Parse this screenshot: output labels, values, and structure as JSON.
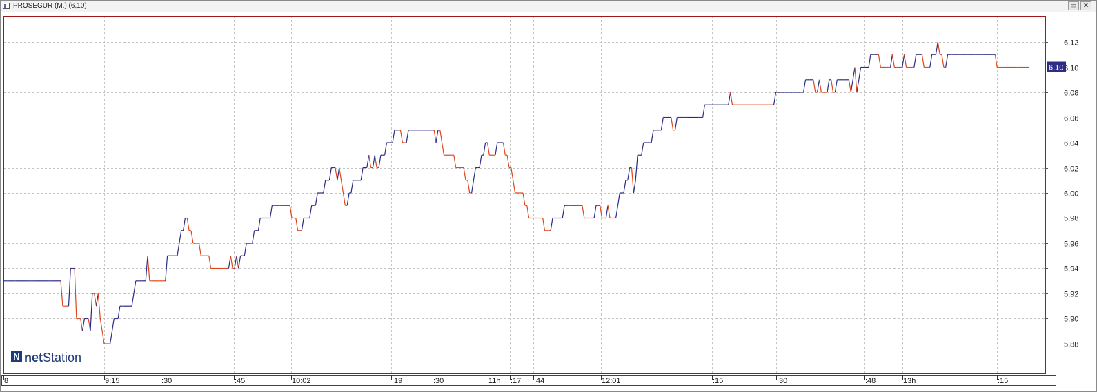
{
  "window": {
    "title": "PROSEGUR (M.) (6,10)",
    "restore_glyph": "▭",
    "close_glyph": "✕"
  },
  "brand": {
    "mark": "N",
    "bold": "net",
    "rest": "Station"
  },
  "colors": {
    "up": "#2a2a86",
    "down": "#e0441a",
    "grid": "#c4c4c4",
    "frame": "#a01818",
    "badge": "#2d2d86"
  },
  "chart_data": {
    "type": "line",
    "title": "PROSEGUR (M.) (6,10)",
    "ylim": [
      5.86,
      6.14
    ],
    "y_ticks": [
      "6,12",
      "6,10",
      "6,08",
      "6,06",
      "6,04",
      "6,02",
      "6,00",
      "5,98",
      "5,96",
      "5,94",
      "5,92",
      "5,90",
      "5,88"
    ],
    "x_ticks": [
      "8",
      "9:15",
      ":30",
      ":45",
      "10:02",
      ":19",
      ":30",
      "11h",
      ":17",
      ":44",
      "12:01",
      ":15",
      ":30",
      ":48",
      "13h",
      ":15"
    ],
    "last_value": "6,10",
    "grid": true,
    "series": [
      {
        "values": [
          5.93,
          5.93,
          5.93,
          5.93,
          5.93,
          5.93,
          5.93,
          5.93,
          5.93,
          5.93,
          5.93,
          5.93,
          5.93,
          5.93,
          5.93,
          5.93,
          5.93,
          5.93,
          5.93,
          5.93,
          5.93,
          5.93,
          5.93,
          5.93,
          5.93,
          5.93,
          5.93,
          5.93,
          5.93,
          5.93,
          5.91,
          5.91,
          5.91,
          5.91,
          5.94,
          5.94,
          5.94,
          5.9,
          5.9,
          5.9,
          5.89,
          5.9,
          5.9,
          5.9,
          5.89,
          5.92,
          5.92,
          5.91,
          5.92,
          5.9,
          5.89,
          5.88,
          5.88,
          5.88,
          5.88,
          5.89,
          5.9,
          5.9,
          5.9,
          5.91,
          5.91,
          5.91,
          5.91,
          5.91,
          5.91,
          5.91,
          5.92,
          5.93,
          5.93,
          5.93,
          5.93,
          5.93,
          5.93,
          5.95,
          5.93,
          5.93,
          5.93,
          5.93,
          5.93,
          5.93,
          5.93,
          5.93,
          5.93,
          5.95,
          5.95,
          5.95,
          5.95,
          5.95,
          5.95,
          5.96,
          5.97,
          5.97,
          5.98,
          5.98,
          5.97,
          5.97,
          5.96,
          5.96,
          5.96,
          5.96,
          5.95,
          5.95,
          5.95,
          5.95,
          5.95,
          5.94,
          5.94,
          5.94,
          5.94,
          5.94,
          5.94,
          5.94,
          5.94,
          5.94,
          5.94,
          5.95,
          5.94,
          5.94,
          5.95,
          5.94,
          5.95,
          5.95,
          5.95,
          5.96,
          5.96,
          5.96,
          5.96,
          5.97,
          5.97,
          5.97,
          5.98,
          5.98,
          5.98,
          5.98,
          5.98,
          5.98,
          5.99,
          5.99,
          5.99,
          5.99,
          5.99,
          5.99,
          5.99,
          5.99,
          5.99,
          5.99,
          5.98,
          5.98,
          5.98,
          5.97,
          5.97,
          5.97,
          5.98,
          5.98,
          5.98,
          5.98,
          5.99,
          5.99,
          5.99,
          6.0,
          6.0,
          6.0,
          6.0,
          6.01,
          6.01,
          6.01,
          6.02,
          6.02,
          6.02,
          6.01,
          6.02,
          6.01,
          6.0,
          5.99,
          5.99,
          6.0,
          6.0,
          6.01,
          6.01,
          6.01,
          6.01,
          6.01,
          6.02,
          6.02,
          6.02,
          6.03,
          6.02,
          6.02,
          6.03,
          6.02,
          6.02,
          6.03,
          6.03,
          6.03,
          6.04,
          6.04,
          6.04,
          6.04,
          6.05,
          6.05,
          6.05,
          6.05,
          6.04,
          6.04,
          6.04,
          6.05,
          6.05,
          6.05,
          6.05,
          6.05,
          6.05,
          6.05,
          6.05,
          6.05,
          6.05,
          6.05,
          6.05,
          6.05,
          6.05,
          6.04,
          6.05,
          6.05,
          6.04,
          6.03,
          6.03,
          6.03,
          6.03,
          6.03,
          6.03,
          6.02,
          6.02,
          6.02,
          6.02,
          6.02,
          6.01,
          6.01,
          6.0,
          6.0,
          6.01,
          6.02,
          6.02,
          6.02,
          6.03,
          6.03,
          6.04,
          6.04,
          6.03,
          6.03,
          6.03,
          6.03,
          6.04,
          6.04,
          6.04,
          6.04,
          6.03,
          6.03,
          6.02,
          6.02,
          6.01,
          6.0,
          6.0,
          6.0,
          6.0,
          6.0,
          5.99,
          5.99,
          5.98,
          5.98,
          5.98,
          5.98,
          5.98,
          5.98,
          5.98,
          5.98,
          5.97,
          5.97,
          5.97,
          5.97,
          5.98,
          5.98,
          5.98,
          5.98,
          5.98,
          5.98,
          5.99,
          5.99,
          5.99,
          5.99,
          5.99,
          5.99,
          5.99,
          5.99,
          5.99,
          5.99,
          5.98,
          5.98,
          5.98,
          5.98,
          5.98,
          5.98,
          5.99,
          5.99,
          5.99,
          5.98,
          5.98,
          5.98,
          5.99,
          5.98,
          5.98,
          5.98,
          5.98,
          5.99,
          6.0,
          6.0,
          6.0,
          6.01,
          6.01,
          6.02,
          6.02,
          6.0,
          6.01,
          6.03,
          6.03,
          6.03,
          6.04,
          6.04,
          6.04,
          6.04,
          6.04,
          6.05,
          6.05,
          6.05,
          6.05,
          6.05,
          6.06,
          6.06,
          6.06,
          6.06,
          6.06,
          6.05,
          6.05,
          6.06,
          6.06,
          6.06,
          6.06,
          6.06,
          6.06,
          6.06,
          6.06,
          6.06,
          6.06,
          6.06,
          6.06,
          6.06,
          6.06,
          6.07,
          6.07,
          6.07,
          6.07,
          6.07,
          6.07,
          6.07,
          6.07,
          6.07,
          6.07,
          6.07,
          6.07,
          6.07,
          6.08,
          6.07,
          6.07,
          6.07,
          6.07,
          6.07,
          6.07,
          6.07,
          6.07,
          6.07,
          6.07,
          6.07,
          6.07,
          6.07,
          6.07,
          6.07,
          6.07,
          6.07,
          6.07,
          6.07,
          6.07,
          6.07,
          6.07,
          6.08,
          6.08,
          6.08,
          6.08,
          6.08,
          6.08,
          6.08,
          6.08,
          6.08,
          6.08,
          6.08,
          6.08,
          6.08,
          6.08,
          6.08,
          6.09,
          6.09,
          6.09,
          6.09,
          6.09,
          6.08,
          6.08,
          6.09,
          6.08,
          6.08,
          6.08,
          6.08,
          6.09,
          6.09,
          6.08,
          6.08,
          6.09,
          6.09,
          6.09,
          6.09,
          6.09,
          6.09,
          6.09,
          6.08,
          6.09,
          6.1,
          6.08,
          6.09,
          6.1,
          6.1,
          6.1,
          6.1,
          6.1,
          6.11,
          6.11,
          6.11,
          6.11,
          6.11,
          6.1,
          6.1,
          6.1,
          6.1,
          6.1,
          6.1,
          6.11,
          6.1,
          6.1,
          6.1,
          6.1,
          6.1,
          6.11,
          6.1,
          6.1,
          6.1,
          6.1,
          6.1,
          6.11,
          6.11,
          6.11,
          6.11,
          6.1,
          6.1,
          6.1,
          6.1,
          6.11,
          6.11,
          6.11,
          6.12,
          6.11,
          6.11,
          6.1,
          6.1,
          6.11,
          6.11,
          6.11,
          6.11,
          6.11,
          6.11,
          6.11,
          6.11,
          6.11,
          6.11,
          6.11,
          6.11,
          6.11,
          6.11,
          6.11,
          6.11,
          6.11,
          6.11,
          6.11,
          6.11,
          6.11,
          6.11,
          6.11,
          6.11,
          6.11,
          6.1,
          6.1,
          6.1,
          6.1,
          6.1,
          6.1,
          6.1,
          6.1,
          6.1,
          6.1,
          6.1,
          6.1,
          6.1,
          6.1,
          6.1,
          6.1,
          6.1
        ]
      }
    ]
  }
}
